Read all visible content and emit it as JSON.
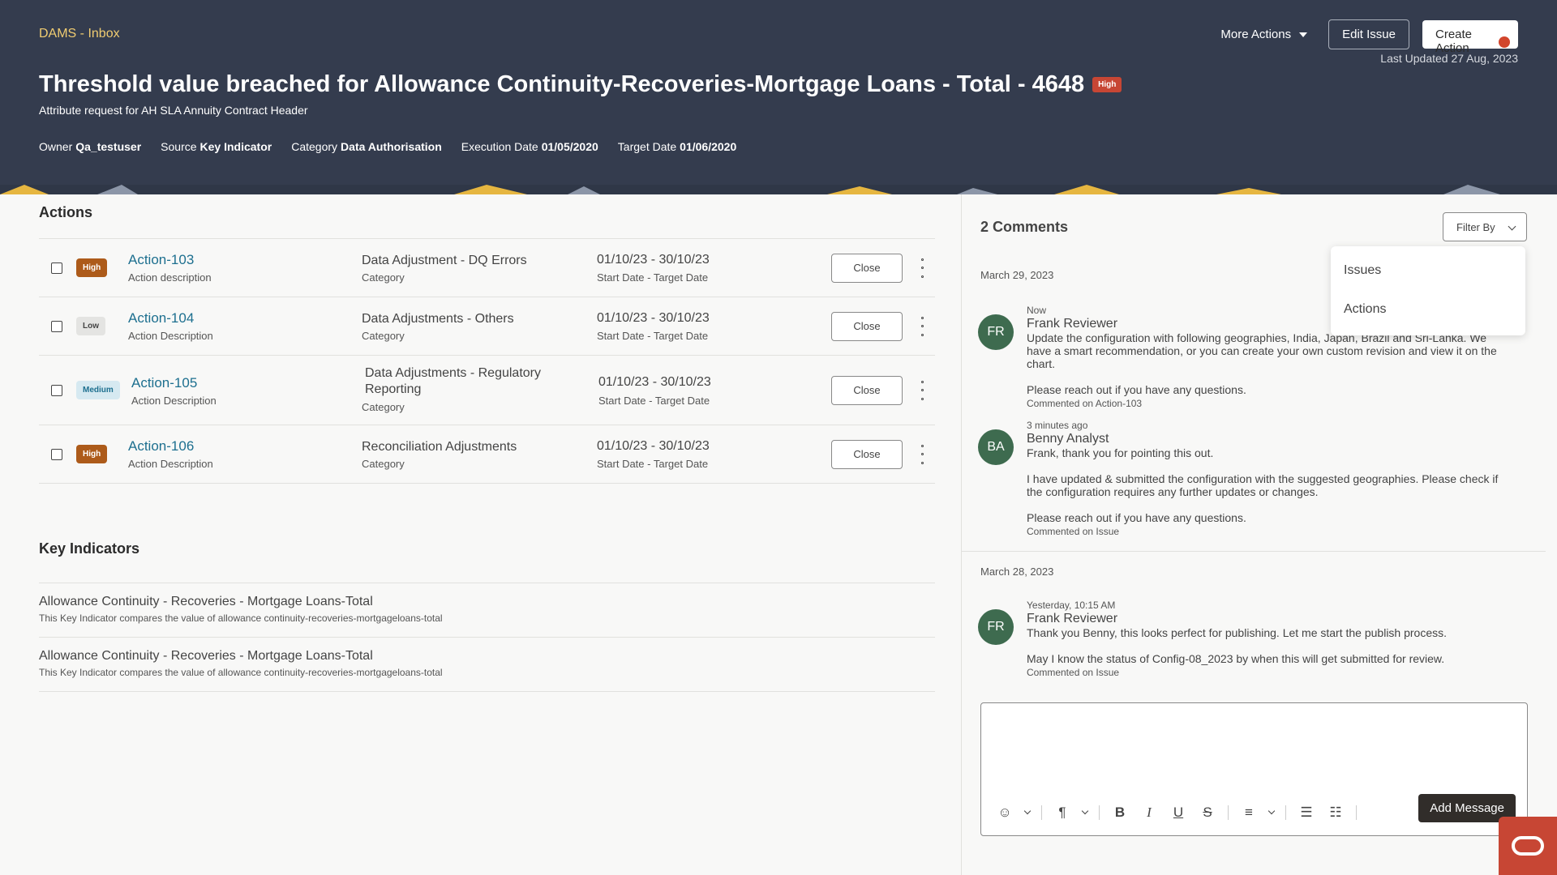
{
  "header": {
    "breadcrumb": "DAMS - Inbox",
    "more_actions": "More Actions",
    "edit_issue": "Edit Issue",
    "create_action": "Create Action",
    "last_updated": "Last Updated 27 Aug, 2023",
    "title": "Threshold value breached for Allowance Continuity-Recoveries-Mortgage Loans - Total - 4648",
    "priority": "High",
    "subtitle": "Attribute request for AH SLA Annuity Contract Header",
    "meta": [
      {
        "label": "Owner",
        "value": "Qa_testuser"
      },
      {
        "label": "Source",
        "value": "Key Indicator"
      },
      {
        "label": "Category",
        "value": "Data Authorisation"
      },
      {
        "label": "Execution Date",
        "value": "01/05/2020"
      },
      {
        "label": "Target Date",
        "value": "01/06/2020"
      }
    ]
  },
  "actions": {
    "title": "Actions",
    "close_label": "Close",
    "rows": [
      {
        "priority": "High",
        "name": "Action-103",
        "desc": "Action description",
        "category": "Data Adjustment - DQ Errors",
        "category_label": "Category",
        "dates": "01/10/23 - 30/10/23",
        "dates_label": "Start Date - Target Date"
      },
      {
        "priority": "Low",
        "name": "Action-104",
        "desc": "Action Description",
        "category": "Data Adjustments - Others",
        "category_label": "Category",
        "dates": "01/10/23 - 30/10/23",
        "dates_label": "Start Date - Target Date"
      },
      {
        "priority": "Medium",
        "name": "Action-105",
        "desc": "Action Description",
        "category": "Data Adjustments - Regulatory Reporting",
        "category_label": "Category",
        "dates": "01/10/23 - 30/10/23",
        "dates_label": "Start Date - Target Date"
      },
      {
        "priority": "High",
        "name": "Action-106",
        "desc": "Action Description",
        "category": "Reconciliation Adjustments",
        "category_label": "Category",
        "dates": "01/10/23 - 30/10/23",
        "dates_label": "Start Date - Target Date"
      }
    ]
  },
  "key_indicators": {
    "title": "Key Indicators",
    "rows": [
      {
        "name": "Allowance Continuity - Recoveries - Mortgage Loans-Total",
        "desc": "This Key Indicator compares the value of allowance continuity-recoveries-mortgageloans-total"
      },
      {
        "name": "Allowance Continuity - Recoveries - Mortgage Loans-Total",
        "desc": "This Key Indicator compares the value of allowance continuity-recoveries-mortgageloans-total"
      }
    ]
  },
  "comments": {
    "title": "2 Comments",
    "filter_label": "Filter By",
    "filter_options": [
      "Issues",
      "Actions"
    ],
    "groups": [
      {
        "date": "March 29, 2023"
      },
      {
        "date": "March 28, 2023"
      }
    ],
    "items": [
      {
        "initials": "FR",
        "time": "Now",
        "author": "Frank Reviewer",
        "paragraphs": [
          "Update the configuration with following geographies, India, Japan, Brazil and Sri-Lanka. We have a smart recommendation, or you can create your own custom revision and view it on the chart.",
          "Please reach out if you have any questions."
        ],
        "ref": "Commented on Action-103"
      },
      {
        "initials": "BA",
        "time": "3 minutes ago",
        "author": "Benny Analyst",
        "paragraphs": [
          "Frank, thank you for pointing this out.",
          "I have updated & submitted the configuration with the suggested geographies. Please check if the configuration requires any further updates or changes.",
          "Please reach out if you have any questions."
        ],
        "ref": "Commented on Issue"
      },
      {
        "initials": "FR",
        "time": "Yesterday, 10:15 AM",
        "author": "Frank Reviewer",
        "paragraphs": [
          "Thank you Benny, this looks perfect for publishing. Let me start the publish process.",
          "May I know the status of Config-08_2023 by when this will get submitted for review."
        ],
        "ref": "Commented on Issue"
      }
    ],
    "add_message": "Add Message"
  }
}
